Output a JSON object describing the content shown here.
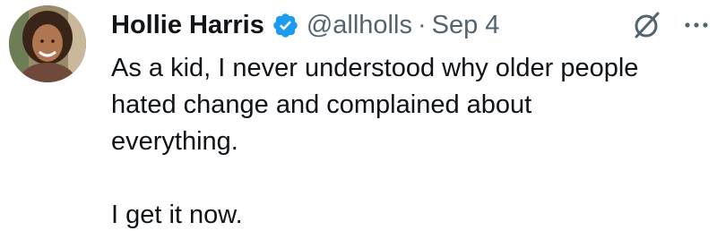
{
  "author": {
    "name": "Hollie Harris",
    "handle": "@allholls",
    "separator": "·",
    "date": "Sep 4",
    "verified": true
  },
  "tweet": {
    "paragraphs": [
      "As a kid, I never understood why older people\nhated change and complained about\neverything.",
      "I get it now."
    ]
  },
  "icons": {
    "verified": "verified-badge-icon",
    "grok": "grok-icon",
    "more": "more-options-icon"
  },
  "colors": {
    "text": "#0f1419",
    "secondary": "#536471",
    "verified": "#1d9bf0"
  }
}
